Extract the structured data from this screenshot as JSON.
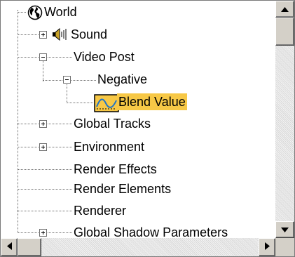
{
  "tree": {
    "root": {
      "label": "World",
      "icon": "globe-icon"
    },
    "nodes": [
      {
        "id": "sound",
        "label": "Sound",
        "icon": "speaker-icon",
        "expander": "collapsed"
      },
      {
        "id": "video-post",
        "label": "Video Post",
        "expander": "expanded"
      },
      {
        "id": "negative",
        "label": "Negative",
        "expander": "expanded"
      },
      {
        "id": "blend-value",
        "label": "Blend Value",
        "icon": "curve-track-icon",
        "selected": true
      },
      {
        "id": "global-tracks",
        "label": "Global Tracks",
        "expander": "collapsed"
      },
      {
        "id": "environment",
        "label": "Environment",
        "expander": "collapsed"
      },
      {
        "id": "render-effects",
        "label": "Render Effects"
      },
      {
        "id": "render-elements",
        "label": "Render Elements"
      },
      {
        "id": "renderer",
        "label": "Renderer"
      },
      {
        "id": "global-shadow-parameters",
        "label": "Global Shadow Parameters",
        "expander": "collapsed"
      }
    ]
  },
  "colors": {
    "selection": "#f7c846",
    "scrollbar_face": "#d4d0c8",
    "tree_lines": "#6b6b6b"
  }
}
